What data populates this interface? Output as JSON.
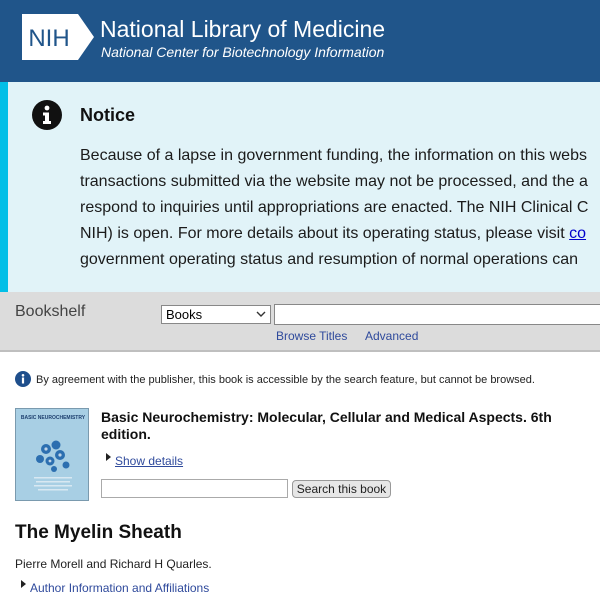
{
  "header": {
    "logo_text": "NIH",
    "title": "National Library of Medicine",
    "subtitle": "National Center for Biotechnology Information",
    "background_color": "#20558a"
  },
  "notice": {
    "heading": "Notice",
    "icon": "info-icon",
    "lines": [
      "Because of a lapse in government funding, the information on this webs",
      "transactions submitted via the website may not be processed, and the a",
      "respond to inquiries until appropriations are enacted. The NIH Clinical C",
      "government operating status and resumption of normal operations can"
    ],
    "line4_prefix": "NIH) is open. For more details about its operating status, please visit ",
    "line4_link": "co",
    "background_color": "#e1f3f8",
    "accent_color": "#02bfe7"
  },
  "bookshelf": {
    "label": "Bookshelf",
    "database_selected": "Books",
    "search_value": "",
    "links": {
      "browse": "Browse Titles",
      "advanced": "Advanced"
    }
  },
  "agreement": {
    "text": "By agreement with the publisher, this book is accessible by the search feature, but cannot be browsed."
  },
  "book": {
    "title": "Basic Neurochemistry: Molecular, Cellular and Medical Aspects. 6th edition.",
    "show_details": "Show details",
    "search_value": "",
    "search_button": "Search this book",
    "cover_text": "BASIC NEUROCHEMISTRY"
  },
  "chapter": {
    "title": "The Myelin Sheath",
    "authors": "Pierre Morell and Richard H Quarles.",
    "author_info_link": "Author Information and Affiliations"
  }
}
